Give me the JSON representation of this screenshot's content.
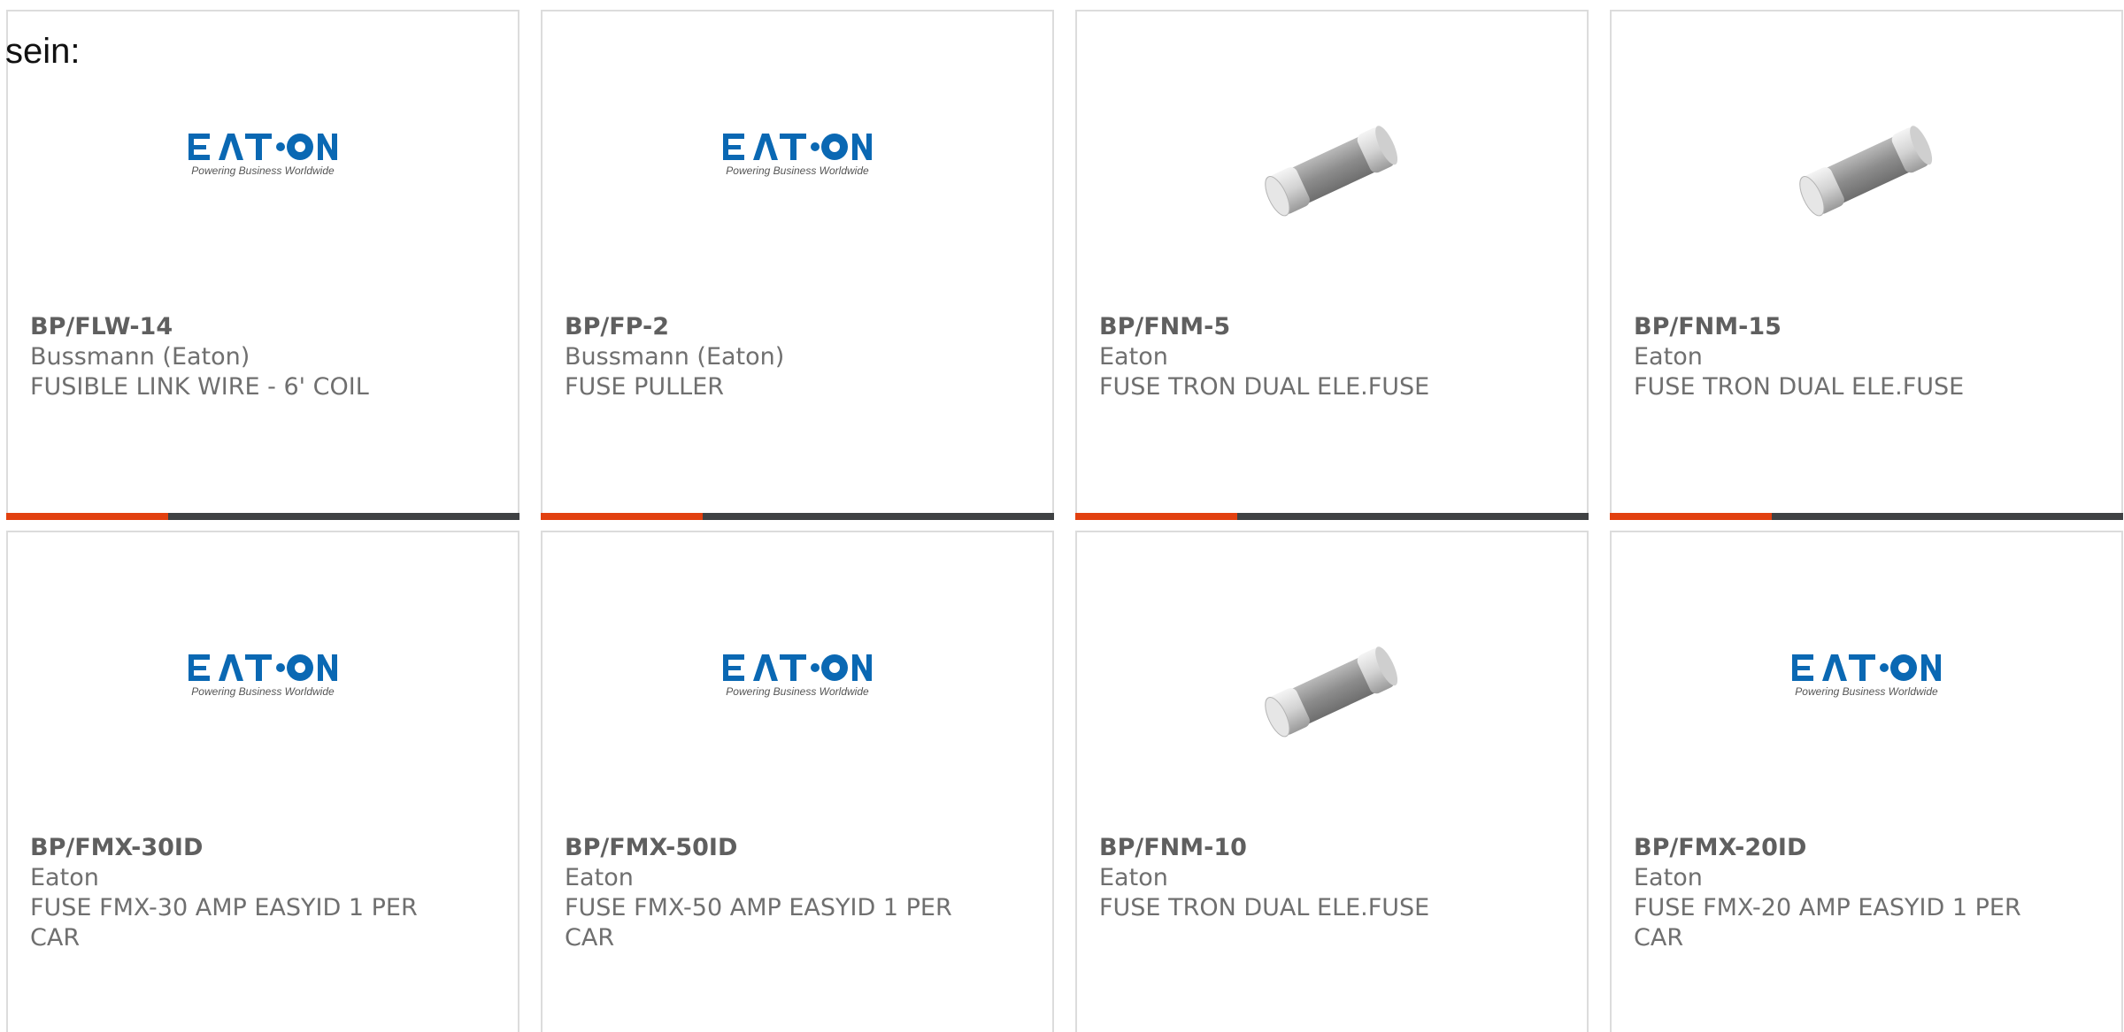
{
  "intro": "sein:",
  "colors": {
    "accent": "#e2400f",
    "bar": "#3f4143",
    "border": "#dcdcdc",
    "eaton_blue": "#0a68b3",
    "text": "#6f6f6f"
  },
  "products": [
    {
      "part_number": "BP/FLW-14",
      "brand": "Bussmann (Eaton)",
      "desc1": "FUSIBLE LINK WIRE - 6' COIL",
      "desc2": "",
      "image": "eaton-logo",
      "logo_text": "E·T·N",
      "logo_tagline": "Powering Business Worldwide"
    },
    {
      "part_number": "BP/FP-2",
      "brand": "Bussmann (Eaton)",
      "desc1": "FUSE PULLER",
      "desc2": "",
      "image": "eaton-logo",
      "logo_text": "E·T·N",
      "logo_tagline": "Powering Business Worldwide"
    },
    {
      "part_number": "BP/FNM-5",
      "brand": "Eaton",
      "desc1": "FUSE TRON DUAL ELE.FUSE",
      "desc2": "",
      "image": "fuse-image"
    },
    {
      "part_number": "BP/FNM-15",
      "brand": "Eaton",
      "desc1": "FUSE TRON DUAL ELE.FUSE",
      "desc2": "",
      "image": "fuse-image"
    },
    {
      "part_number": "BP/FMX-30ID",
      "brand": "Eaton",
      "desc1": "FUSE FMX-30 AMP EASYID 1 PER",
      "desc2": "CAR",
      "image": "eaton-logo",
      "logo_text": "E·T·N",
      "logo_tagline": "Powering Business Worldwide"
    },
    {
      "part_number": "BP/FMX-50ID",
      "brand": "Eaton",
      "desc1": "FUSE FMX-50 AMP EASYID 1 PER",
      "desc2": "CAR",
      "image": "eaton-logo",
      "logo_text": "E·T·N",
      "logo_tagline": "Powering Business Worldwide"
    },
    {
      "part_number": "BP/FNM-10",
      "brand": "Eaton",
      "desc1": "FUSE TRON DUAL ELE.FUSE",
      "desc2": "",
      "image": "fuse-image"
    },
    {
      "part_number": "BP/FMX-20ID",
      "brand": "Eaton",
      "desc1": "FUSE FMX-20 AMP EASYID 1 PER",
      "desc2": "CAR",
      "image": "eaton-logo",
      "logo_text": "E·T·N",
      "logo_tagline": "Powering Business Worldwide"
    }
  ]
}
